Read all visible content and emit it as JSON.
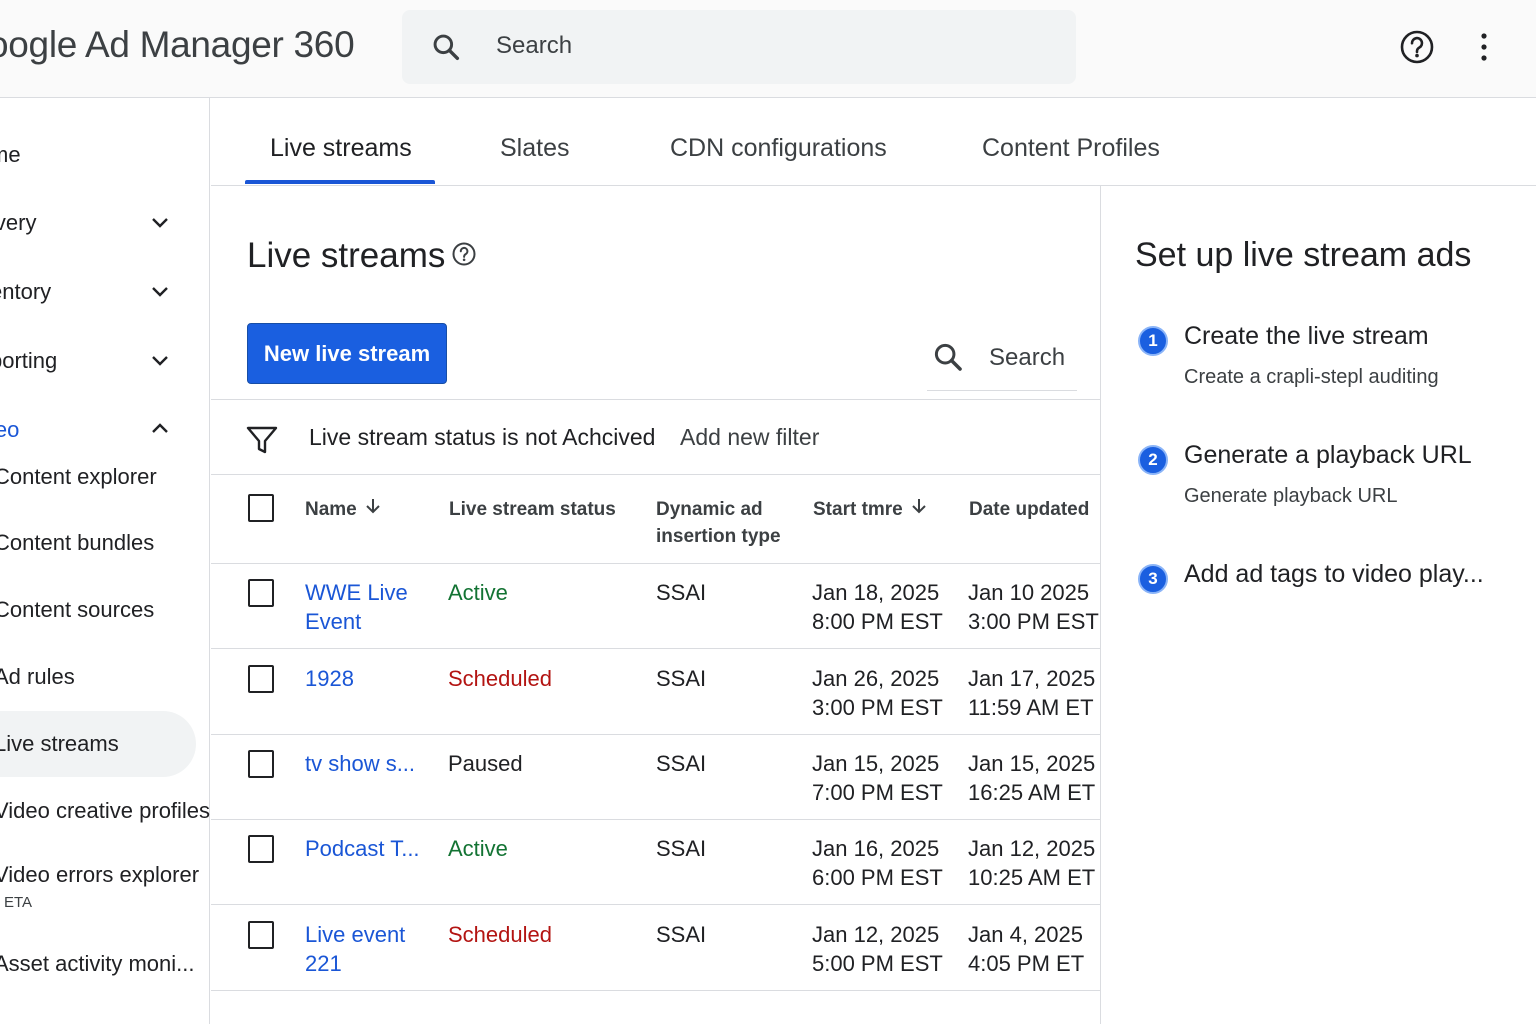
{
  "app": {
    "title": "oogle Ad Manager 360"
  },
  "search": {
    "placeholder": "Search"
  },
  "icons": {
    "help": "help-circle-icon",
    "more": "more-vert-icon",
    "search": "search-icon",
    "filter": "filter-icon",
    "chevron_down": "chevron-down-icon",
    "chevron_up": "chevron-up-icon",
    "sort": "arrow-down-icon"
  },
  "colors": {
    "accent": "#1a5fe0",
    "link": "#1a56d6",
    "active": "#137333",
    "scheduled": "#b31412"
  },
  "sidebar": {
    "items": [
      {
        "label": "me"
      },
      {
        "label": "ivery"
      },
      {
        "label": "entory"
      },
      {
        "label": "porting"
      },
      {
        "label": "leo"
      }
    ],
    "video_items": [
      {
        "label": "Content explorer"
      },
      {
        "label": "Content bundles"
      },
      {
        "label": "Content sources"
      },
      {
        "label": "Ad rules"
      },
      {
        "label": "Live streams"
      },
      {
        "label": "Video creative profiles"
      },
      {
        "label": "Video errors explorer",
        "badge": "ETA"
      },
      {
        "label": "Asset activity moni..."
      }
    ]
  },
  "tabs": [
    {
      "label": "Live streams"
    },
    {
      "label": "Slates"
    },
    {
      "label": "CDN configurations"
    },
    {
      "label": "Content Profiles"
    }
  ],
  "main": {
    "title": "Live streams",
    "new_button": "New live stream",
    "search_label": "Search",
    "filter": {
      "chip": "Live stream status is not Achcived",
      "add": "Add new filter"
    },
    "columns": {
      "name": "Name",
      "status": "Live stream status",
      "dai_line1": "Dynamic ad",
      "dai_line2": "insertion type",
      "start": "Start tmre",
      "updated": "Date updated"
    },
    "rows": [
      {
        "name1": "WWE Live",
        "name2": "Event",
        "status": "Active",
        "dai": "SSAI",
        "start1": "Jan 18, 2025",
        "start2": "8:00 PM EST",
        "upd1": "Jan 10 2025",
        "upd2": "3:00 PM EST"
      },
      {
        "name1": "1928",
        "name2": "",
        "status": "Scheduled",
        "dai": "SSAI",
        "start1": "Jan 26, 2025",
        "start2": "3:00 PM EST",
        "upd1": "Jan 17, 2025",
        "upd2": "11:59 AM ET"
      },
      {
        "name1": "tv show s...",
        "name2": "",
        "status": "Paused",
        "dai": "SSAI",
        "start1": "Jan 15, 2025",
        "start2": "7:00 PM EST",
        "upd1": "Jan 15, 2025",
        "upd2": "16:25 AM ET"
      },
      {
        "name1": "Podcast T...",
        "name2": "",
        "status": "Active",
        "dai": "SSAI",
        "start1": "Jan 16, 2025",
        "start2": "6:00 PM EST",
        "upd1": "Jan 12, 2025",
        "upd2": "10:25 AM ET"
      },
      {
        "name1": "Live event",
        "name2": "221",
        "status": "Scheduled",
        "dai": "SSAI",
        "start1": "Jan 12, 2025",
        "start2": "5:00 PM EST",
        "upd1": "Jan 4, 2025",
        "upd2": "4:05 PM ET"
      }
    ]
  },
  "panel": {
    "title": "Set up live stream ads",
    "steps": [
      {
        "num": "1",
        "title": "Create the live stream",
        "desc": "Create a crapli-stepl auditing"
      },
      {
        "num": "2",
        "title": "Generate a playback URL",
        "desc": "Generate playback URL"
      },
      {
        "num": "3",
        "title": "Add ad tags to video play...",
        "desc": ""
      }
    ]
  }
}
